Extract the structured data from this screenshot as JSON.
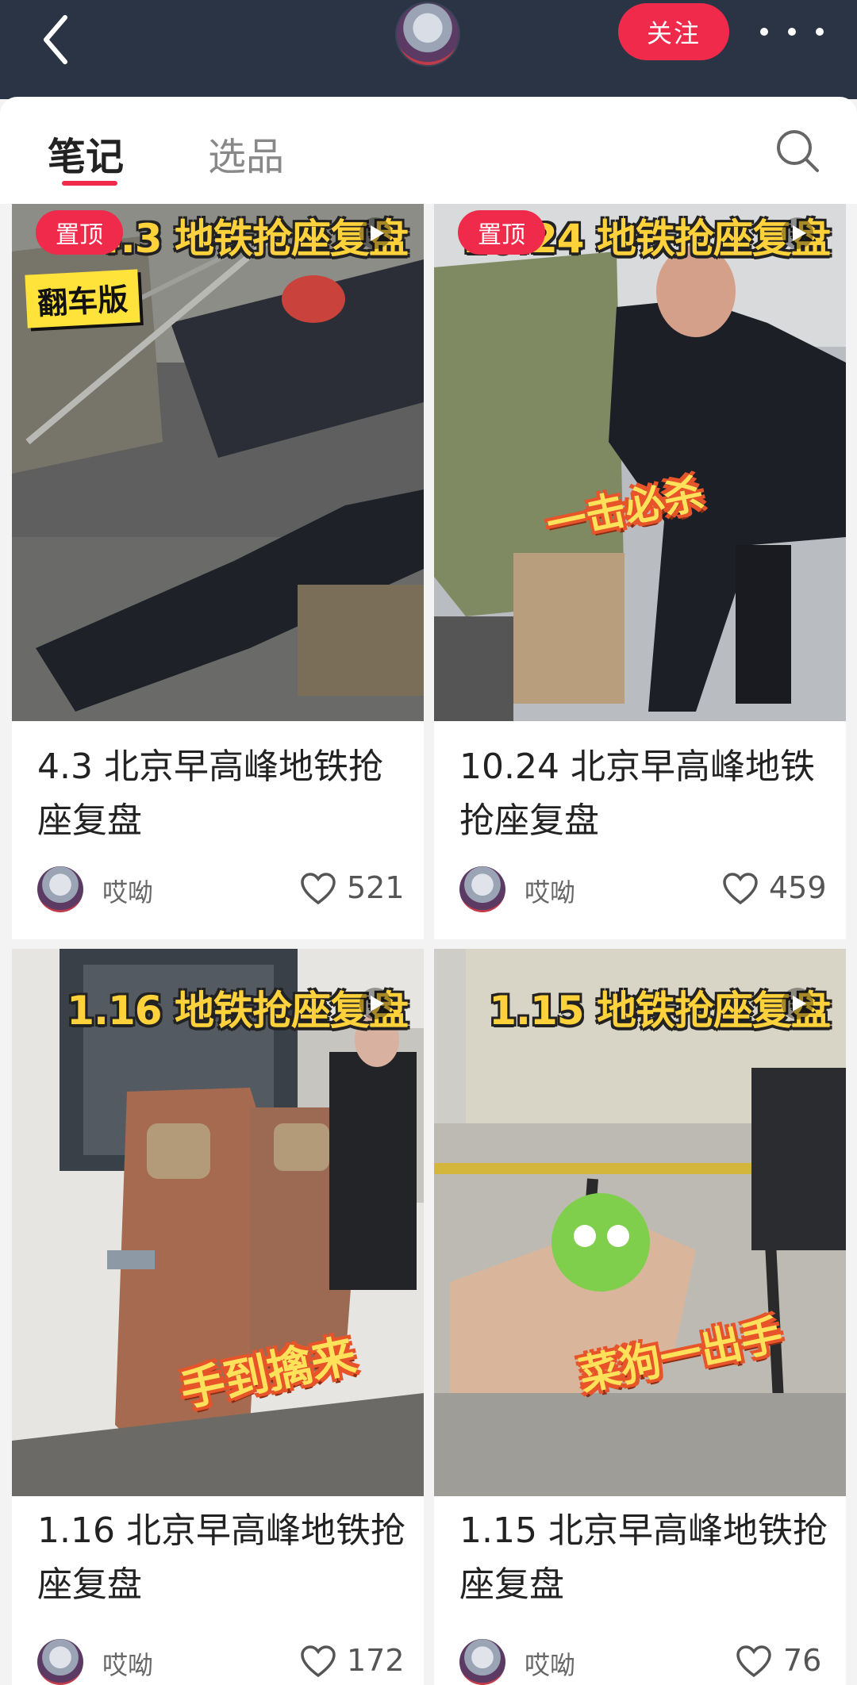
{
  "header": {
    "follow_label": "关注"
  },
  "tabs": [
    {
      "label": "笔记",
      "active": true
    },
    {
      "label": "选品",
      "active": false
    }
  ],
  "colors": {
    "accent": "#ef2a4a",
    "topbar": "#2b3445",
    "overlay_text": "#ffd23c"
  },
  "icons": [
    "back-arrow-icon",
    "more-dots-icon",
    "search-icon",
    "heart-icon",
    "play-icon"
  ],
  "notes": [
    {
      "title": "4.3 北京早高峰地铁抢座复盘",
      "pinned": true,
      "pin_label": "置顶",
      "overlay": "4.3 地铁抢座复盘",
      "badge": "翻车版",
      "sticker": "",
      "author": "哎呦",
      "likes": "521"
    },
    {
      "title": "10.24 北京早高峰地铁抢座复盘",
      "pinned": true,
      "pin_label": "置顶",
      "overlay": "10.24 地铁抢座复盘",
      "badge": "",
      "sticker": "一击必杀",
      "author": "哎呦",
      "likes": "459"
    },
    {
      "title": "1.16 北京早高峰地铁抢座复盘",
      "pinned": false,
      "overlay": "1.16 地铁抢座复盘",
      "badge": "",
      "sticker": "手到擒来",
      "author": "哎呦",
      "likes": "172"
    },
    {
      "title": "1.15 北京早高峰地铁抢座复盘",
      "pinned": false,
      "overlay": "1.15 地铁抢座复盘",
      "badge": "",
      "sticker": "菜狗一出手",
      "author": "哎呦",
      "likes": "76"
    }
  ]
}
